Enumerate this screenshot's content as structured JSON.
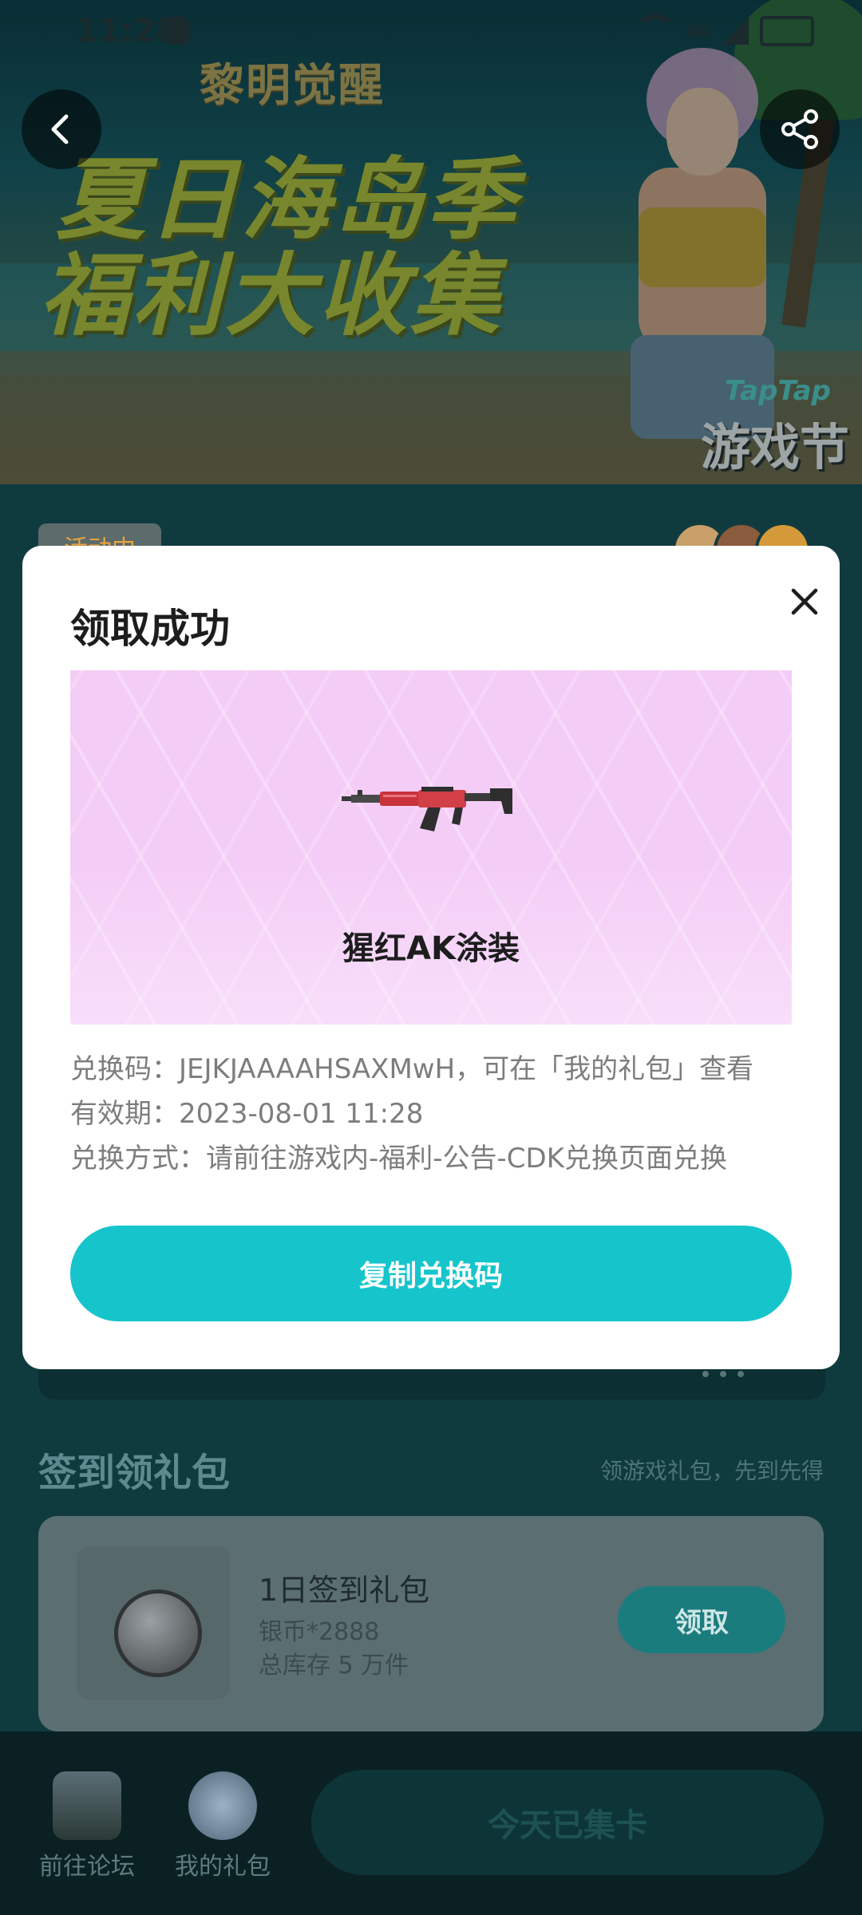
{
  "status_bar": {
    "time": "11:28",
    "network": "4G"
  },
  "banner": {
    "game_logo": "黎明觉醒",
    "headline_line1": "夏日海岛季",
    "headline_line2": "福利大收集",
    "fest_badge_top": "TapTap",
    "fest_badge_main": "游戏节"
  },
  "header": {
    "back_icon": "chevron-left-icon",
    "share_icon": "share-icon"
  },
  "background": {
    "activity_tag": "活动中",
    "section_title": "签到领礼包",
    "section_subtitle": "领游戏礼包，先到先得",
    "gift_item": {
      "name": "1日签到礼包",
      "desc": "银币*2888",
      "stock": "总库存 5 万件",
      "claim_label": "领取"
    }
  },
  "bottom_bar": {
    "forum_label": "前往论坛",
    "my_gifts_label": "我的礼包",
    "collect_label": "今天已集卡"
  },
  "modal": {
    "title": "领取成功",
    "prize_name": "猩红AK涂装",
    "code_line": "兑换码：JEJKJAAAAHSAXMwH，可在「我的礼包」查看",
    "validity_line": "有效期：2023-08-01 11:28",
    "method_line": "兑换方式：请前往游戏内-福利-公告-CDK兑换页面兑换",
    "copy_button": "复制兑换码",
    "colors": {
      "accent": "#16c5cc",
      "prize_bg": "#f4cdf7"
    }
  }
}
